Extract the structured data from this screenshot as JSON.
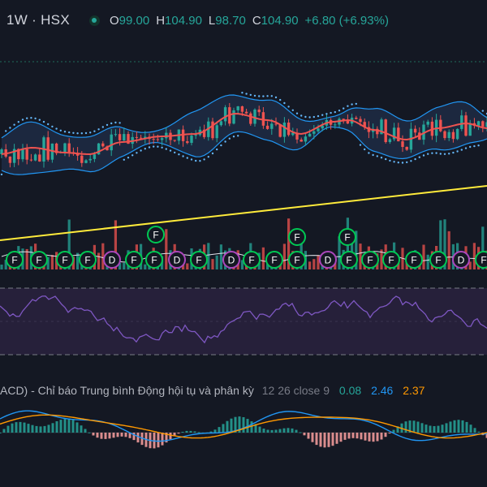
{
  "header": {
    "symbol": "1W · HSX",
    "ohlc_open_key": "O",
    "ohlc_open": "99.00",
    "ohlc_high_key": "H",
    "ohlc_high": "104.90",
    "ohlc_low_key": "L",
    "ohlc_low": "98.70",
    "ohlc_close_key": "C",
    "ohlc_close": "104.90",
    "change": "+6.80 (+6.93%)"
  },
  "macd_header": {
    "title": "ACD) - Chỉ báo Trung bình Động hội tụ và phân kỳ",
    "params": "12 26 close 9",
    "histogram": "0.08",
    "macd": "2.46",
    "signal": "2.37"
  },
  "event_markers": [
    "F",
    "F",
    "F",
    "F",
    "D",
    "F",
    "F",
    "D",
    "F",
    "D",
    "F",
    "F",
    "F",
    "D",
    "F",
    "F",
    "F",
    "F",
    "F",
    "D",
    "F",
    "F",
    "F",
    "F"
  ],
  "colors": {
    "background": "#141823",
    "up": "#26a69a",
    "down": "#ef5350",
    "bollinger": "#2196f3",
    "basis": "#ef5350",
    "trendline": "#ffeb3b",
    "rsi": "#7e57c2",
    "macd_line": "#2196f3",
    "signal_line": "#ff9800",
    "event_F": "#00c853",
    "event_D": "#ab47bc"
  },
  "chart_data": [
    {
      "type": "candlestick",
      "title": "1W · HSX",
      "last_bar": {
        "open": 99.0,
        "high": 104.9,
        "low": 98.7,
        "close": 104.9,
        "change": 6.8,
        "change_pct": 6.93
      },
      "overlays": [
        "bollinger bands",
        "moving average",
        "parabolic SAR",
        "trendline"
      ],
      "grid": false
    },
    {
      "type": "bar",
      "panel": "volume",
      "overlays": [
        "volume moving average"
      ]
    },
    {
      "type": "line",
      "panel": "RSI",
      "overlays": [
        "upper band",
        "lower band"
      ]
    },
    {
      "type": "bar",
      "panel": "MACD",
      "title": "ACD) - Chỉ báo Trung bình Động hội tụ và phân kỳ",
      "params": "12 26 close 9",
      "series": [
        {
          "name": "0.08",
          "kind": "histogram"
        },
        {
          "name": "2.46",
          "kind": "line"
        },
        {
          "name": "2.37",
          "kind": "line"
        }
      ]
    }
  ]
}
